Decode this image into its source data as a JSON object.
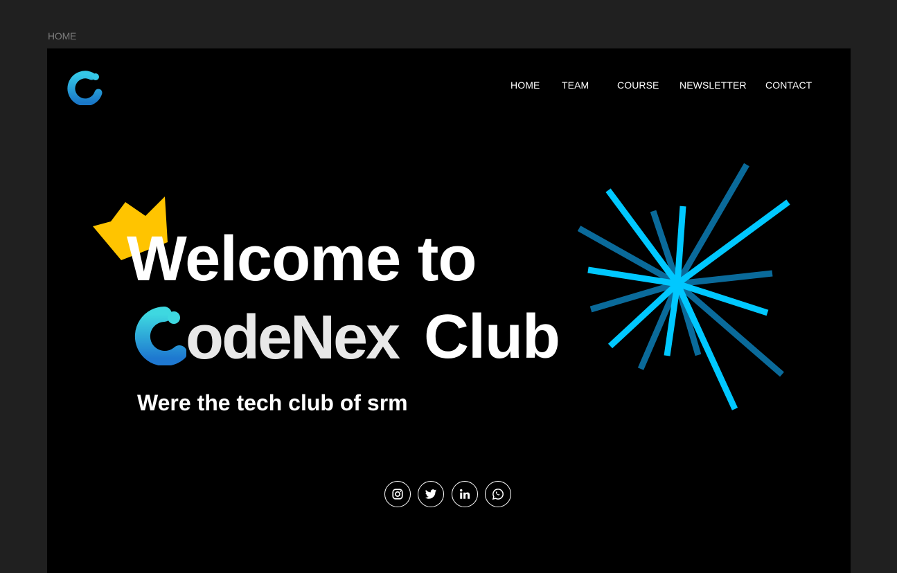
{
  "page_label": "HOME",
  "nav": {
    "items": [
      {
        "label": "HOME"
      },
      {
        "label": "TEAM"
      },
      {
        "label": "COURSE"
      },
      {
        "label": "NEWSLETTER"
      },
      {
        "label": "CONTACT"
      }
    ]
  },
  "hero": {
    "line1": "Welcome to",
    "brand": "odeNex",
    "club": "Club",
    "tagline": "Were the tech club of srm"
  },
  "socials": [
    {
      "icon": "instagram-icon"
    },
    {
      "icon": "twitter-icon"
    },
    {
      "icon": "linkedin-icon"
    },
    {
      "icon": "whatsapp-icon"
    }
  ],
  "colors": {
    "accent_blue": "#1E8BD6",
    "accent_cyan": "#35C8E8",
    "crown_yellow": "#FFC400",
    "burst_bright": "#00C8FF",
    "burst_dark": "#0A6A9A"
  }
}
